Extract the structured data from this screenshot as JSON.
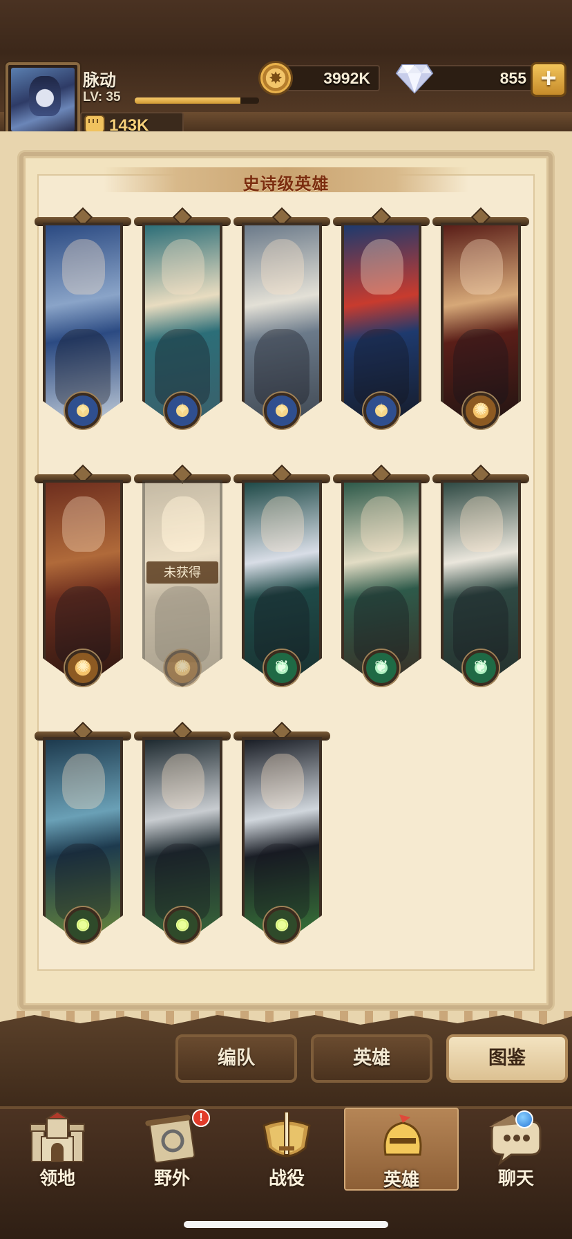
{
  "player": {
    "name": "脉动",
    "level_text": "LV: 35",
    "xp_progress": 0.85,
    "power": "143K"
  },
  "currency": {
    "gold": "3992K",
    "diamonds": "855",
    "add_label": "+"
  },
  "section": {
    "title": "史诗级英雄"
  },
  "heroes": [
    {
      "faction": "lightbearer",
      "owned": true,
      "colors": [
        "#2b4a82",
        "#8aa4c8",
        "#c9d3dd"
      ]
    },
    {
      "faction": "lightbearer",
      "owned": true,
      "colors": [
        "#2c6e78",
        "#e8dcc0",
        "#3b5f6a"
      ]
    },
    {
      "faction": "lightbearer",
      "owned": true,
      "colors": [
        "#6b7a8a",
        "#e3e0d6",
        "#3e4650"
      ]
    },
    {
      "faction": "lightbearer",
      "owned": true,
      "colors": [
        "#1e3a6e",
        "#c83b2e",
        "#151a26"
      ]
    },
    {
      "faction": "mauler",
      "owned": true,
      "colors": [
        "#5a1e18",
        "#d6a878",
        "#1e1412"
      ]
    },
    {
      "faction": "mauler",
      "owned": true,
      "colors": [
        "#6e2e1e",
        "#b06a3a",
        "#2a1610"
      ]
    },
    {
      "faction": "mauler",
      "owned": false,
      "locked_label": "未获得",
      "colors": [
        "#9a7040",
        "#d4a868",
        "#6a4a28"
      ]
    },
    {
      "faction": "wilder",
      "owned": true,
      "colors": [
        "#1f4a48",
        "#d8dde6",
        "#18302f"
      ]
    },
    {
      "faction": "wilder",
      "owned": true,
      "colors": [
        "#2e5a4a",
        "#e2dcc4",
        "#3a2e24"
      ]
    },
    {
      "faction": "wilder",
      "owned": true,
      "colors": [
        "#2f4a44",
        "#eae6dc",
        "#24302c"
      ]
    },
    {
      "faction": "graveborn",
      "owned": true,
      "colors": [
        "#1d3a4e",
        "#6aa0b6",
        "#6a8a3a"
      ]
    },
    {
      "faction": "graveborn",
      "owned": true,
      "colors": [
        "#1e2a30",
        "#c8ccd0",
        "#3a6a3a"
      ]
    },
    {
      "faction": "graveborn",
      "owned": true,
      "colors": [
        "#1a1e26",
        "#d0d6dc",
        "#3a7a3a"
      ]
    }
  ],
  "sub_tabs": [
    {
      "label": "编队",
      "active": false
    },
    {
      "label": "英雄",
      "active": false
    },
    {
      "label": "图鉴",
      "active": true
    }
  ],
  "nav": [
    {
      "label": "领地",
      "icon": "castle-icon",
      "active": false
    },
    {
      "label": "野外",
      "icon": "map-scroll-icon",
      "active": false,
      "alert": "!"
    },
    {
      "label": "战役",
      "icon": "sword-shield-icon",
      "active": false
    },
    {
      "label": "英雄",
      "icon": "helmet-icon",
      "active": true
    },
    {
      "label": "聊天",
      "icon": "chat-bubble-icon",
      "active": false,
      "info_dot": true
    }
  ]
}
